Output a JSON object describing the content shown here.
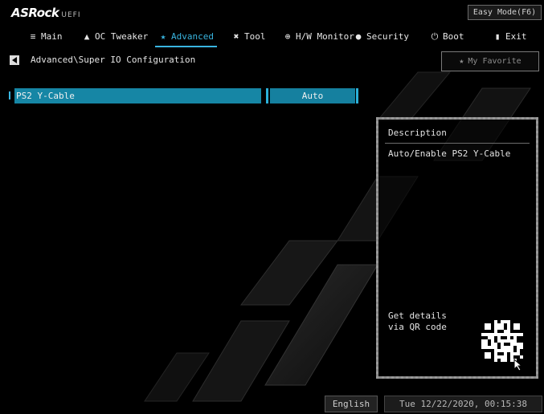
{
  "brand": {
    "name": "ASRock",
    "suffix": "UEFI"
  },
  "easy_mode_label": "Easy Mode(F6)",
  "menu": [
    {
      "label": "Main",
      "icon": "list-icon",
      "active": false
    },
    {
      "label": "OC Tweaker",
      "icon": "rocket-icon",
      "active": false
    },
    {
      "label": "Advanced",
      "icon": "star-icon",
      "active": true
    },
    {
      "label": "Tool",
      "icon": "wrench-icon",
      "active": false
    },
    {
      "label": "H/W Monitor",
      "icon": "monitor-icon",
      "active": false
    },
    {
      "label": "Security",
      "icon": "shield-icon",
      "active": false
    },
    {
      "label": "Boot",
      "icon": "power-icon",
      "active": false
    },
    {
      "label": "Exit",
      "icon": "exit-icon",
      "active": false
    }
  ],
  "breadcrumb": "Advanced\\Super IO Configuration",
  "favorite_label": "My Favorite",
  "settings": [
    {
      "label": "PS2 Y-Cable",
      "value": "Auto",
      "selected": true
    }
  ],
  "description": {
    "title": "Description",
    "text": "Auto/Enable PS2 Y-Cable",
    "qr_text": "Get details via QR code"
  },
  "footer": {
    "language": "English",
    "datetime": "Tue 12/22/2020, 00:15:38"
  },
  "colors": {
    "accent": "#39b5e0",
    "selected_row": "#1686a5",
    "background": "#000000"
  }
}
